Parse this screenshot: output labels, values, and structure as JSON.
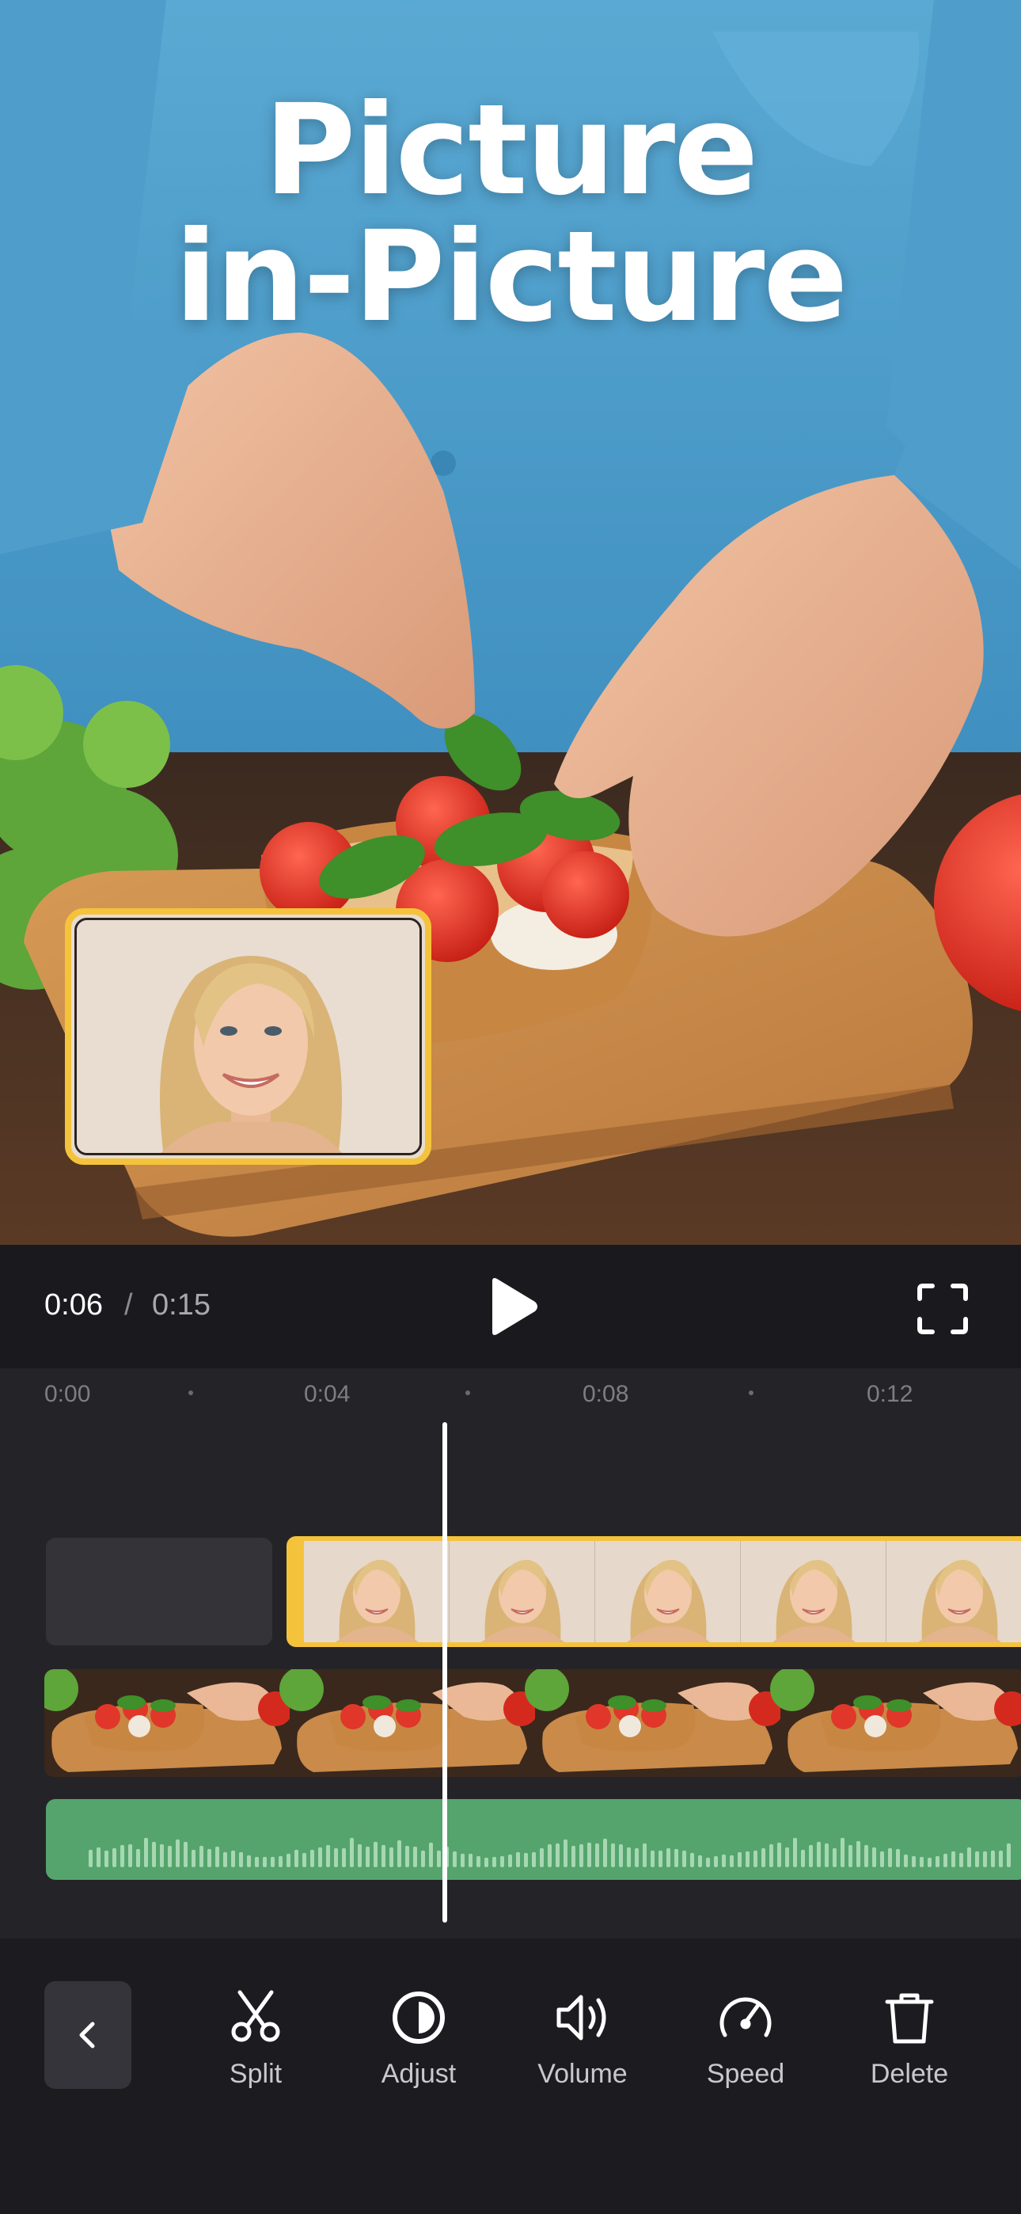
{
  "hero": {
    "title_line1": "Picture",
    "title_line2": "in-Picture"
  },
  "player": {
    "current_time": "0:06",
    "separator": "/",
    "total_time": "0:15",
    "play_icon": "play-icon",
    "fullscreen_icon": "fullscreen-icon"
  },
  "timeline": {
    "ticks": [
      "0:00",
      "0:04",
      "0:08",
      "0:12"
    ],
    "playhead_time_seconds": 6
  },
  "toolbar": {
    "back_icon": "chevron-left-icon",
    "tools": [
      {
        "label": "Split",
        "icon": "scissors-icon"
      },
      {
        "label": "Adjust",
        "icon": "adjust-icon"
      },
      {
        "label": "Volume",
        "icon": "volume-icon"
      },
      {
        "label": "Speed",
        "icon": "speedometer-icon"
      },
      {
        "label": "Delete",
        "icon": "trash-icon"
      }
    ]
  },
  "colors": {
    "accent": "#f5c33b",
    "audio_track": "#55a46d",
    "background": "#1a1a1e"
  }
}
